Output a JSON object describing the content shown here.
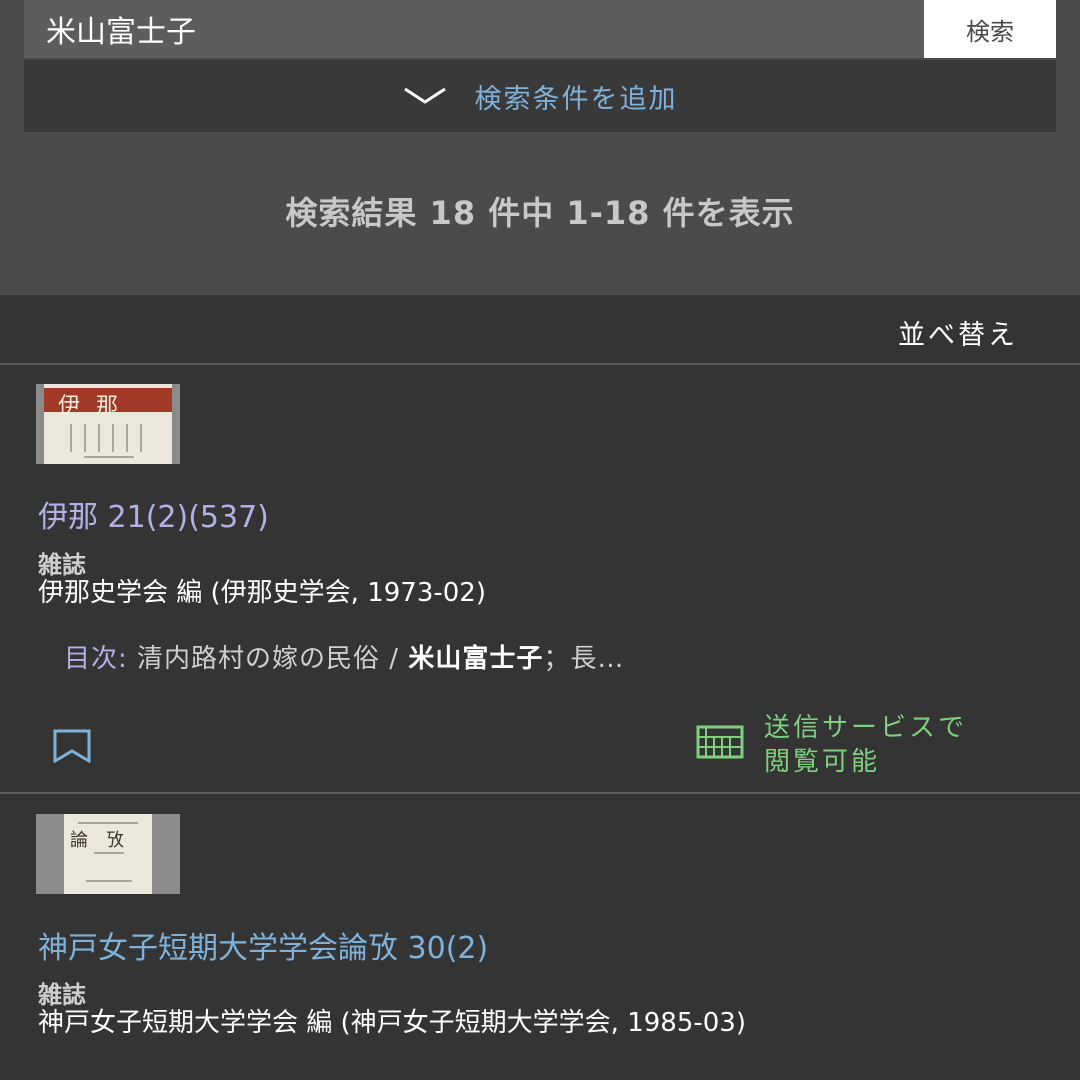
{
  "search": {
    "query": "米山富士子",
    "button_label": "検索",
    "add_condition_label": "検索条件を追加"
  },
  "results": {
    "summary": "検索結果 18 件中 1-18 件を表示",
    "sort_label": "並べ替え",
    "items": [
      {
        "title": "伊那 21(2)(537)",
        "type": "雑誌",
        "publisher": "伊那史学会 編 (伊那史学会, 1973-02)",
        "toc_label": "目次:",
        "toc_before": " 清内路村の嫁の民俗 / ",
        "toc_highlight": "米山富士子",
        "toc_after": "；長…",
        "online_label_line1": "送信サービスで",
        "online_label_line2": "閲覧可能",
        "thumbnail_glyphs": "伊那"
      },
      {
        "title": "神戸女子短期大学学会論攷 30(2)",
        "type": "雑誌",
        "publisher": "神戸女子短期大学学会 編 (神戸女子短期大学学会, 1985-03)",
        "thumbnail_glyphs": "論攷"
      }
    ]
  },
  "colors": {
    "link": "#7fb2da",
    "visited_link": "#b2b0e6",
    "online": "#7ed07e",
    "panel": "#343434",
    "header": "#4b4b4b"
  },
  "icons": {
    "expand": "chevron-down-icon",
    "bookmark": "bookmark-icon",
    "online_access": "online-access-icon"
  }
}
